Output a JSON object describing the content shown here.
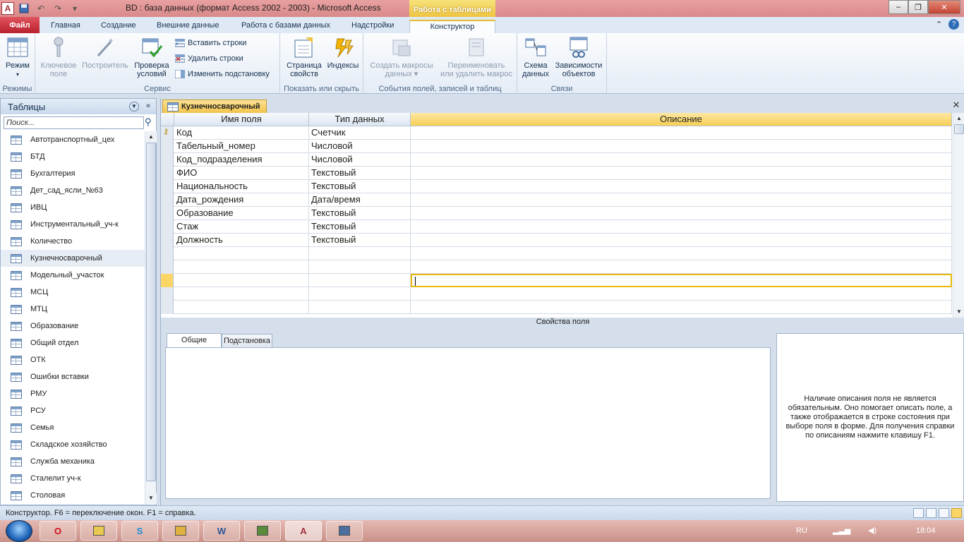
{
  "window": {
    "title": "BD : база данных (формат Access 2002 - 2003)  -  Microsoft Access",
    "contextual_tab_group": "Работа с таблицами",
    "app_icon_letter": "A"
  },
  "ribbon_tabs": [
    "Файл",
    "Главная",
    "Создание",
    "Внешние данные",
    "Работа с базами данных",
    "Надстройки",
    "Конструктор"
  ],
  "ribbon": {
    "groups": {
      "modes": "Режимы",
      "tools": "Сервис",
      "show_hide": "Показать или скрыть",
      "events": "События полей, записей и таблиц",
      "relations": "Связи"
    },
    "buttons": {
      "mode": "Режим",
      "key_field_1": "Ключевое",
      "key_field_2": "поле",
      "builder": "Построитель",
      "validate_1": "Проверка",
      "validate_2": "условий",
      "insert_rows": "Вставить строки",
      "delete_rows": "Удалить строки",
      "modify_lookup": "Изменить подстановку",
      "property_sheet_1": "Страница",
      "property_sheet_2": "свойств",
      "indexes": "Индексы",
      "create_macros_1": "Создать макросы",
      "create_macros_2": "данных ▾",
      "rename_macro_1": "Переименовать",
      "rename_macro_2": "или удалить макрос",
      "relationships_1": "Схема",
      "relationships_2": "данных",
      "dependencies_1": "Зависимости",
      "dependencies_2": "объектов"
    }
  },
  "nav": {
    "header": "Таблицы",
    "search_placeholder": "Поиск...",
    "items": [
      "Автотранспортный_цех",
      "БТД",
      "Бухгалтерия",
      "Дет_сад_ясли_№63",
      "ИВЦ",
      "Инструментальный_уч-к",
      "Количество",
      "Кузнечносварочный",
      "Модельный_участок",
      "МСЦ",
      "МТЦ",
      "Образование",
      "Общий отдел",
      "ОТК",
      "Ошибки вставки",
      "РМУ",
      "РСУ",
      "Семья",
      "Складское хозяйство",
      "Служба механика",
      "Сталелит уч-к",
      "Столовая"
    ],
    "selected_index": 7
  },
  "document": {
    "tab_label": "Кузнечносварочный",
    "columns": [
      "Имя поля",
      "Тип данных",
      "Описание"
    ],
    "rows": [
      {
        "name": "Код",
        "type": "Счетчик",
        "description": "",
        "primary_key": true
      },
      {
        "name": "Табельный_номер",
        "type": "Числовой",
        "description": ""
      },
      {
        "name": "Код_подразделения",
        "type": "Числовой",
        "description": ""
      },
      {
        "name": "ФИО",
        "type": "Текстовый",
        "description": ""
      },
      {
        "name": "Национальность",
        "type": "Текстовый",
        "description": ""
      },
      {
        "name": "Дата_рождения",
        "type": "Дата/время",
        "description": ""
      },
      {
        "name": "Образование",
        "type": "Текстовый",
        "description": ""
      },
      {
        "name": "Стаж",
        "type": "Текстовый",
        "description": ""
      },
      {
        "name": "Должность",
        "type": "Текстовый",
        "description": ""
      }
    ],
    "field_properties_label": "Свойства поля",
    "property_tabs": [
      "Общие",
      "Подстановка"
    ],
    "help_text": "Наличие описания поля не является обязательным. Оно помогает описать поле, а также отображается в строке состояния при выборе поля в форме. Для получения справки по описаниям нажмите клавишу F1."
  },
  "statusbar": {
    "text": "Конструктор.  F6 = переключение окон.  F1 = справка."
  },
  "taskbar": {
    "language": "RU",
    "clock": "18:04",
    "apps": [
      "opera-icon",
      "explorer-icon",
      "skype-icon",
      "folder-icon",
      "word-icon",
      "paint-icon",
      "access-icon",
      "window-icon"
    ],
    "app_letters": [
      "O",
      "",
      "S",
      "",
      "W",
      "",
      "A",
      ""
    ]
  },
  "colors": {
    "accent": "#f7cf55",
    "file_tab": "#b9212e",
    "ribbon_text": "#15304f"
  }
}
